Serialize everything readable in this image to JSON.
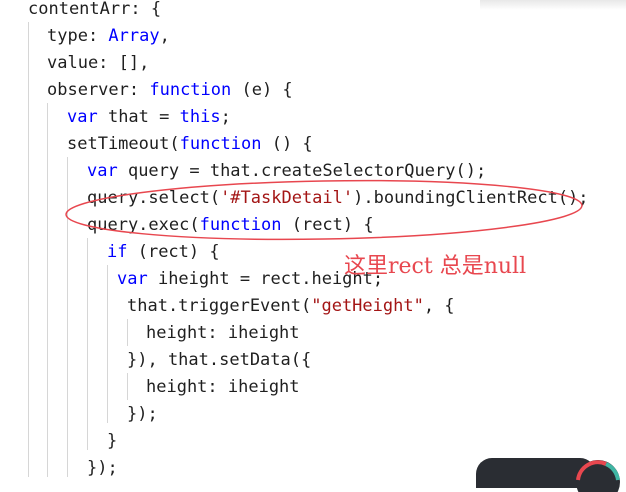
{
  "code_editor": {
    "lines": [
      {
        "indent": 28,
        "tokens": [
          {
            "text": "contentArr: {",
            "kind": "plain"
          }
        ]
      },
      {
        "indent": 47,
        "tokens": [
          {
            "text": "type: ",
            "kind": "plain"
          },
          {
            "text": "Array",
            "kind": "kw"
          },
          {
            "text": ",",
            "kind": "plain"
          }
        ]
      },
      {
        "indent": 47,
        "tokens": [
          {
            "text": "value: [],",
            "kind": "plain"
          }
        ]
      },
      {
        "indent": 47,
        "tokens": [
          {
            "text": "observer: ",
            "kind": "plain"
          },
          {
            "text": "function",
            "kind": "kw"
          },
          {
            "text": " (e) {",
            "kind": "plain"
          }
        ]
      },
      {
        "indent": 67,
        "tokens": [
          {
            "text": "var",
            "kind": "kw"
          },
          {
            "text": " that = ",
            "kind": "plain"
          },
          {
            "text": "this",
            "kind": "kw"
          },
          {
            "text": ";",
            "kind": "plain"
          }
        ]
      },
      {
        "indent": 67,
        "tokens": [
          {
            "text": "setTimeout(",
            "kind": "plain"
          },
          {
            "text": "function",
            "kind": "kw"
          },
          {
            "text": " () {",
            "kind": "plain"
          }
        ]
      },
      {
        "indent": 87,
        "tokens": [
          {
            "text": "var",
            "kind": "kw"
          },
          {
            "text": " query = that.createSelectorQuery();",
            "kind": "plain"
          }
        ]
      },
      {
        "indent": 87,
        "tokens": [
          {
            "text": "query.select(",
            "kind": "plain"
          },
          {
            "text": "'#TaskDetail'",
            "kind": "str"
          },
          {
            "text": ").boundingClientRect();",
            "kind": "plain"
          }
        ]
      },
      {
        "indent": 87,
        "tokens": [
          {
            "text": "query.exec(",
            "kind": "plain"
          },
          {
            "text": "function",
            "kind": "kw"
          },
          {
            "text": " (rect) {",
            "kind": "plain"
          }
        ]
      },
      {
        "indent": 107,
        "tokens": [
          {
            "text": "if",
            "kind": "kw"
          },
          {
            "text": " (rect) {",
            "kind": "plain"
          }
        ]
      },
      {
        "indent": 117,
        "tokens": [
          {
            "text": "var",
            "kind": "kw"
          },
          {
            "text": " iheight = rect.height;",
            "kind": "plain"
          }
        ]
      },
      {
        "indent": 127,
        "tokens": [
          {
            "text": "that.triggerEvent(",
            "kind": "plain"
          },
          {
            "text": "\"getHeight\"",
            "kind": "str"
          },
          {
            "text": ", {",
            "kind": "plain"
          }
        ]
      },
      {
        "indent": 146,
        "tokens": [
          {
            "text": "height: iheight",
            "kind": "plain"
          }
        ]
      },
      {
        "indent": 127,
        "tokens": [
          {
            "text": "}), that.setData({",
            "kind": "plain"
          }
        ]
      },
      {
        "indent": 146,
        "tokens": [
          {
            "text": "height: iheight",
            "kind": "plain"
          }
        ]
      },
      {
        "indent": 127,
        "tokens": [
          {
            "text": "});",
            "kind": "plain"
          }
        ]
      },
      {
        "indent": 107,
        "tokens": [
          {
            "text": "}",
            "kind": "plain"
          }
        ]
      },
      {
        "indent": 87,
        "tokens": [
          {
            "text": "});",
            "kind": "plain"
          }
        ]
      }
    ]
  },
  "annotation": {
    "text": "这里rect 总是null",
    "color": "#e8474f"
  },
  "colors": {
    "keyword": "#0000ff",
    "string": "#a31515",
    "plain": "#1f1f1f",
    "indent_guide": "#d6d6d6"
  }
}
